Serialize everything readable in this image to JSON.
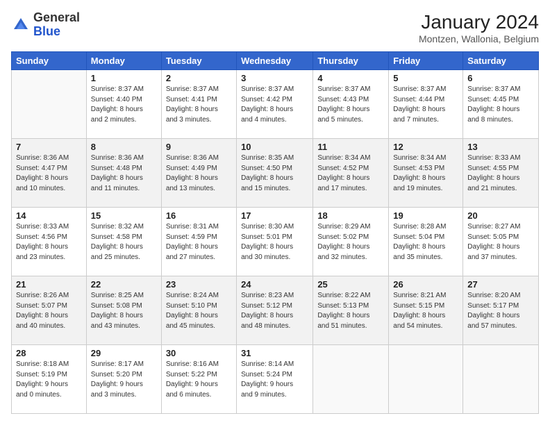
{
  "header": {
    "logo_general": "General",
    "logo_blue": "Blue",
    "month_year": "January 2024",
    "location": "Montzen, Wallonia, Belgium"
  },
  "weekdays": [
    "Sunday",
    "Monday",
    "Tuesday",
    "Wednesday",
    "Thursday",
    "Friday",
    "Saturday"
  ],
  "weeks": [
    [
      {
        "day": "",
        "info": ""
      },
      {
        "day": "1",
        "info": "Sunrise: 8:37 AM\nSunset: 4:40 PM\nDaylight: 8 hours\nand 2 minutes."
      },
      {
        "day": "2",
        "info": "Sunrise: 8:37 AM\nSunset: 4:41 PM\nDaylight: 8 hours\nand 3 minutes."
      },
      {
        "day": "3",
        "info": "Sunrise: 8:37 AM\nSunset: 4:42 PM\nDaylight: 8 hours\nand 4 minutes."
      },
      {
        "day": "4",
        "info": "Sunrise: 8:37 AM\nSunset: 4:43 PM\nDaylight: 8 hours\nand 5 minutes."
      },
      {
        "day": "5",
        "info": "Sunrise: 8:37 AM\nSunset: 4:44 PM\nDaylight: 8 hours\nand 7 minutes."
      },
      {
        "day": "6",
        "info": "Sunrise: 8:37 AM\nSunset: 4:45 PM\nDaylight: 8 hours\nand 8 minutes."
      }
    ],
    [
      {
        "day": "7",
        "info": "Sunrise: 8:36 AM\nSunset: 4:47 PM\nDaylight: 8 hours\nand 10 minutes."
      },
      {
        "day": "8",
        "info": "Sunrise: 8:36 AM\nSunset: 4:48 PM\nDaylight: 8 hours\nand 11 minutes."
      },
      {
        "day": "9",
        "info": "Sunrise: 8:36 AM\nSunset: 4:49 PM\nDaylight: 8 hours\nand 13 minutes."
      },
      {
        "day": "10",
        "info": "Sunrise: 8:35 AM\nSunset: 4:50 PM\nDaylight: 8 hours\nand 15 minutes."
      },
      {
        "day": "11",
        "info": "Sunrise: 8:34 AM\nSunset: 4:52 PM\nDaylight: 8 hours\nand 17 minutes."
      },
      {
        "day": "12",
        "info": "Sunrise: 8:34 AM\nSunset: 4:53 PM\nDaylight: 8 hours\nand 19 minutes."
      },
      {
        "day": "13",
        "info": "Sunrise: 8:33 AM\nSunset: 4:55 PM\nDaylight: 8 hours\nand 21 minutes."
      }
    ],
    [
      {
        "day": "14",
        "info": "Sunrise: 8:33 AM\nSunset: 4:56 PM\nDaylight: 8 hours\nand 23 minutes."
      },
      {
        "day": "15",
        "info": "Sunrise: 8:32 AM\nSunset: 4:58 PM\nDaylight: 8 hours\nand 25 minutes."
      },
      {
        "day": "16",
        "info": "Sunrise: 8:31 AM\nSunset: 4:59 PM\nDaylight: 8 hours\nand 27 minutes."
      },
      {
        "day": "17",
        "info": "Sunrise: 8:30 AM\nSunset: 5:01 PM\nDaylight: 8 hours\nand 30 minutes."
      },
      {
        "day": "18",
        "info": "Sunrise: 8:29 AM\nSunset: 5:02 PM\nDaylight: 8 hours\nand 32 minutes."
      },
      {
        "day": "19",
        "info": "Sunrise: 8:28 AM\nSunset: 5:04 PM\nDaylight: 8 hours\nand 35 minutes."
      },
      {
        "day": "20",
        "info": "Sunrise: 8:27 AM\nSunset: 5:05 PM\nDaylight: 8 hours\nand 37 minutes."
      }
    ],
    [
      {
        "day": "21",
        "info": "Sunrise: 8:26 AM\nSunset: 5:07 PM\nDaylight: 8 hours\nand 40 minutes."
      },
      {
        "day": "22",
        "info": "Sunrise: 8:25 AM\nSunset: 5:08 PM\nDaylight: 8 hours\nand 43 minutes."
      },
      {
        "day": "23",
        "info": "Sunrise: 8:24 AM\nSunset: 5:10 PM\nDaylight: 8 hours\nand 45 minutes."
      },
      {
        "day": "24",
        "info": "Sunrise: 8:23 AM\nSunset: 5:12 PM\nDaylight: 8 hours\nand 48 minutes."
      },
      {
        "day": "25",
        "info": "Sunrise: 8:22 AM\nSunset: 5:13 PM\nDaylight: 8 hours\nand 51 minutes."
      },
      {
        "day": "26",
        "info": "Sunrise: 8:21 AM\nSunset: 5:15 PM\nDaylight: 8 hours\nand 54 minutes."
      },
      {
        "day": "27",
        "info": "Sunrise: 8:20 AM\nSunset: 5:17 PM\nDaylight: 8 hours\nand 57 minutes."
      }
    ],
    [
      {
        "day": "28",
        "info": "Sunrise: 8:18 AM\nSunset: 5:19 PM\nDaylight: 9 hours\nand 0 minutes."
      },
      {
        "day": "29",
        "info": "Sunrise: 8:17 AM\nSunset: 5:20 PM\nDaylight: 9 hours\nand 3 minutes."
      },
      {
        "day": "30",
        "info": "Sunrise: 8:16 AM\nSunset: 5:22 PM\nDaylight: 9 hours\nand 6 minutes."
      },
      {
        "day": "31",
        "info": "Sunrise: 8:14 AM\nSunset: 5:24 PM\nDaylight: 9 hours\nand 9 minutes."
      },
      {
        "day": "",
        "info": ""
      },
      {
        "day": "",
        "info": ""
      },
      {
        "day": "",
        "info": ""
      }
    ]
  ]
}
